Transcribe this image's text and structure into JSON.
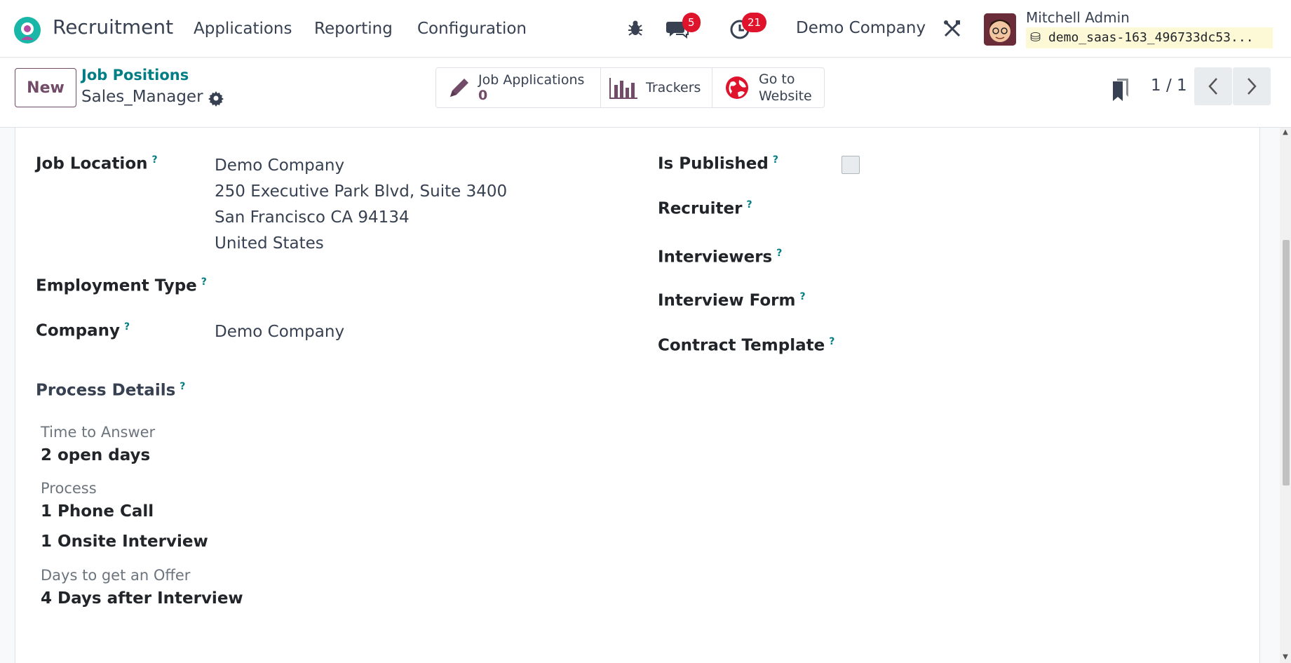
{
  "navbar": {
    "app_name": "Recruitment",
    "menu": [
      "Applications",
      "Reporting",
      "Configuration"
    ],
    "messages_count": "5",
    "activities_count": "21",
    "company": "Demo Company",
    "user_name": "Mitchell Admin",
    "db_name": "demo_saas-163_496733dc53..."
  },
  "control": {
    "new_label": "New",
    "breadcrumb": "Job Positions",
    "record_name": "Sales_Manager",
    "smart_buttons": {
      "applications_label": "Job Applications",
      "applications_count": "0",
      "trackers_label": "Trackers",
      "website_line1": "Go to",
      "website_line2": "Website"
    },
    "pager": "1 / 1"
  },
  "form": {
    "job_location_label": "Job Location",
    "job_location_lines": [
      "Demo Company",
      "250 Executive Park Blvd, Suite 3400",
      "San Francisco CA 94134",
      "United States"
    ],
    "employment_type_label": "Employment Type",
    "company_label": "Company",
    "company_value": "Demo Company",
    "is_published_label": "Is Published",
    "recruiter_label": "Recruiter",
    "interviewers_label": "Interviewers",
    "interview_form_label": "Interview Form",
    "contract_template_label": "Contract Template",
    "help_mark": "?"
  },
  "process": {
    "title": "Process Details",
    "time_label": "Time to Answer",
    "time_value": "2 open days",
    "process_label": "Process",
    "steps": [
      "1 Phone Call",
      "1 Onsite Interview"
    ],
    "offer_label": "Days to get an Offer",
    "offer_value": "4 Days after Interview"
  },
  "colors": {
    "brand": "#714b67",
    "link": "#017e84",
    "badge": "#e0132c"
  }
}
